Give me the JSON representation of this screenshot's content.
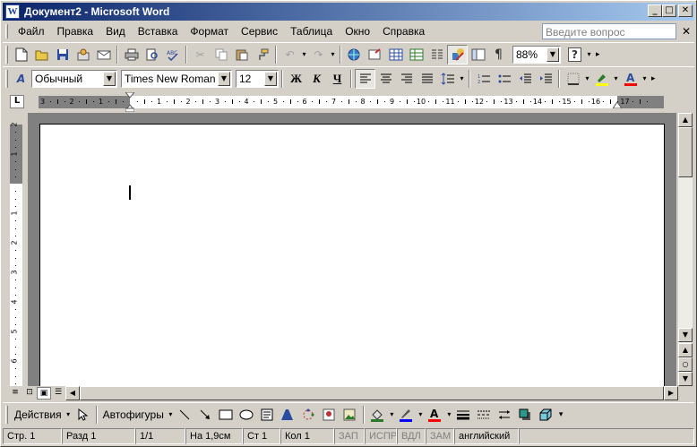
{
  "window": {
    "title": "Документ2 - Microsoft Word",
    "app_icon": "W",
    "minimize": "_",
    "maximize": "□",
    "close": "✕"
  },
  "menu": {
    "items": [
      "Файл",
      "Правка",
      "Вид",
      "Вставка",
      "Формат",
      "Сервис",
      "Таблица",
      "Окно",
      "Справка"
    ],
    "help_placeholder": "Введите вопрос",
    "close_doc": "✕"
  },
  "standard_toolbar": {
    "zoom": "88%",
    "help_glyph": "?"
  },
  "formatting_toolbar": {
    "style": "Обычный",
    "font": "Times New Roman",
    "size": "12",
    "bold": "Ж",
    "italic": "К",
    "underline": "Ч"
  },
  "ruler": {
    "h_labels": [
      "3",
      "2",
      "1",
      "1",
      "2",
      "3",
      "4",
      "5",
      "6",
      "7",
      "8",
      "9",
      "10",
      "11",
      "12",
      "13",
      "14",
      "15",
      "16",
      "17"
    ],
    "v_labels": [
      "2",
      "1",
      "1",
      "2",
      "3",
      "4",
      "5",
      "6"
    ],
    "corner_glyph": "L"
  },
  "drawing_toolbar": {
    "actions": "Действия",
    "autoshapes": "Автофигуры"
  },
  "status": {
    "page": "Стр.  1",
    "section": "Разд  1",
    "pages": "1/1",
    "at": "На 1,9см",
    "line": "Ст  1",
    "col": "Кол  1",
    "rec": "ЗАП",
    "trk": "ИСПР",
    "ext": "ВДЛ",
    "ovr": "ЗАМ",
    "lang": "английский"
  },
  "colors": {
    "title_start": "#0a246a",
    "title_end": "#a6caf0",
    "chrome": "#d4d0c8",
    "highlight": "#ffff00",
    "font_color": "#ff0000",
    "pen_color": "#0000ff"
  }
}
